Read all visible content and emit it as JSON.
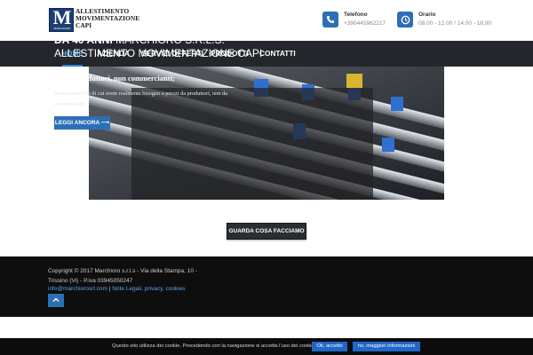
{
  "logo": {
    "mark_letter": "M",
    "mark_sub": "MARCHIORO",
    "lines": [
      "ALLESTIMENTO",
      "MOVIMENTAZIONE",
      "CAPI"
    ]
  },
  "contacts": [
    {
      "icon": "phone-icon",
      "label": "Telefono",
      "value": "+390445962217"
    },
    {
      "icon": "clock-icon",
      "label": "Orario",
      "value": "08.00 - 12.00 / 14.00 - 18.00"
    }
  ],
  "nav": {
    "items": [
      {
        "label": "HOME",
        "active": true
      },
      {
        "label": "AZIENDA",
        "active": false
      },
      {
        "label": "SERVIZI OFFERTI",
        "active": false
      },
      {
        "label": "PRODOTTI",
        "active": false
      },
      {
        "label": "CONTATTI",
        "active": false
      }
    ]
  },
  "slider": {
    "title_bold": "DA 40 ANNI",
    "title_rest": " MARCHIORO S.R.L.S. ALLESTIMENTO MOVIMENTAZIONE CAPI",
    "subtitle": "Siamo produttori, non commercianti;",
    "body": "Realizziamo ciò di cui avete realmente bisogno a prezzi da produttori, non da commercianti.",
    "button_label": "LEGGI ANCORA ⟶"
  },
  "cta": {
    "label": "GUARDA COSA FACCIAMO"
  },
  "footer": {
    "copyright": "Copyright © 2017 Marchioro s.r.l.s - Via della Stampa, 10 - Trissino (Vi) -  P.iva 03945050247",
    "email": "info@marchiorosrl.com",
    "separator": " | ",
    "legal": "Note Legali, privacy, cookies",
    "totop_icon": "chevron-up-icon"
  },
  "cookie": {
    "message": "Questo sito utilizza dei cookie. Procedendo con la navigazione si accetta l'uso dei cookie.",
    "accept": "Ok, accetto",
    "more": "no, maggiori informazioni"
  },
  "colors": {
    "accent": "#2d6fb5",
    "nav_bg": "#23262b",
    "footer_bg": "#0e0e0e",
    "logo_blue": "#1d3e73"
  }
}
